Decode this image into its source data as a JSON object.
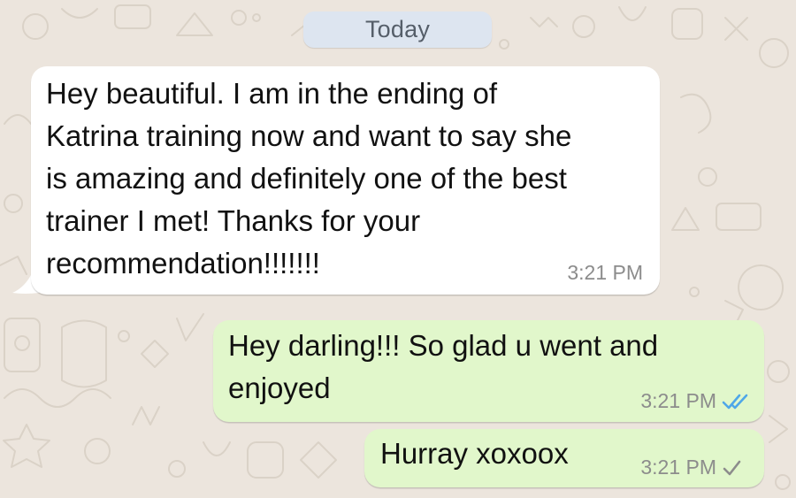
{
  "date_separator": "Today",
  "messages": [
    {
      "direction": "incoming",
      "text": "Hey beautiful. I am in the ending of\nKatrina training now and want to say she\nis amazing and definitely one of the best\ntrainer I met! Thanks for your\nrecommendation!!!!!!!",
      "time": "3:21 PM"
    },
    {
      "direction": "outgoing",
      "text": "Hey darling!!! So glad u went and\nenjoyed",
      "time": "3:21 PM",
      "status": "read",
      "status_icon": "double-check-icon"
    },
    {
      "direction": "outgoing",
      "text": "Hurray xoxoox",
      "time": "3:21 PM",
      "status": "sent",
      "status_icon": "single-check-icon"
    }
  ],
  "colors": {
    "background": "#ece5dd",
    "incoming_bubble": "#ffffff",
    "outgoing_bubble": "#e1f7cb",
    "date_pill": "#dde5f0",
    "read_tick": "#4fa7e8",
    "sent_tick": "#8c8c8c"
  }
}
